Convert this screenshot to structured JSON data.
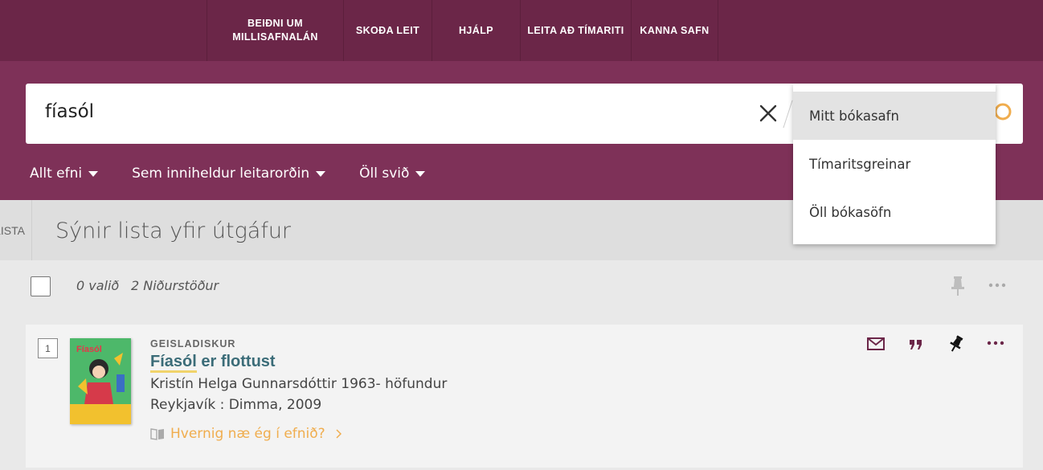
{
  "nav": {
    "items": [
      {
        "label_line1": "BEIÐNI UM",
        "label_line2": "MILLISAFNALÁN"
      },
      {
        "label_line1": "SKOÐA LEIT",
        "label_line2": ""
      },
      {
        "label_line1": "HJÁLP",
        "label_line2": ""
      },
      {
        "label_line1": "LEITA AÐ TÍMARITI",
        "label_line2": ""
      },
      {
        "label_line1": "KANNA SAFN",
        "label_line2": ""
      }
    ]
  },
  "search": {
    "query": "fíasól",
    "icons": {
      "clear": "close-icon",
      "submit": "search-icon"
    },
    "filters": [
      {
        "label": "Allt efni"
      },
      {
        "label": "Sem inniheldur leitarorðin"
      },
      {
        "label": "Öll svið"
      }
    ],
    "scope_dropdown": {
      "options": [
        "Mitt bókasafn",
        "Tímaritsgreinar",
        "Öll bókasöfn"
      ],
      "selected": "Mitt bókasafn"
    }
  },
  "list": {
    "tab_label": "LISTA",
    "title": "Sýnir lista yfir útgáfur"
  },
  "results_bar": {
    "selected_count": "0 valið",
    "result_count": "2 Niðurstöður"
  },
  "results": [
    {
      "number": "1",
      "type": "GEISLADISKUR",
      "title_highlight": "Fíasól",
      "title_rest": " er flottust",
      "author": "Kristín Helga Gunnarsdóttir 1963- höfundur",
      "publisher": "Reykjavík : Dimma, 2009",
      "access_link": "Hvernig næ ég í efnið?",
      "cover_text": "Fíasól"
    }
  ],
  "colors": {
    "nav_bg": "#6b2648",
    "search_band_bg": "#7e3158",
    "accent_orange": "#f0ad4e",
    "title_link": "#3b6c78",
    "action_icons": "#6b2648"
  }
}
